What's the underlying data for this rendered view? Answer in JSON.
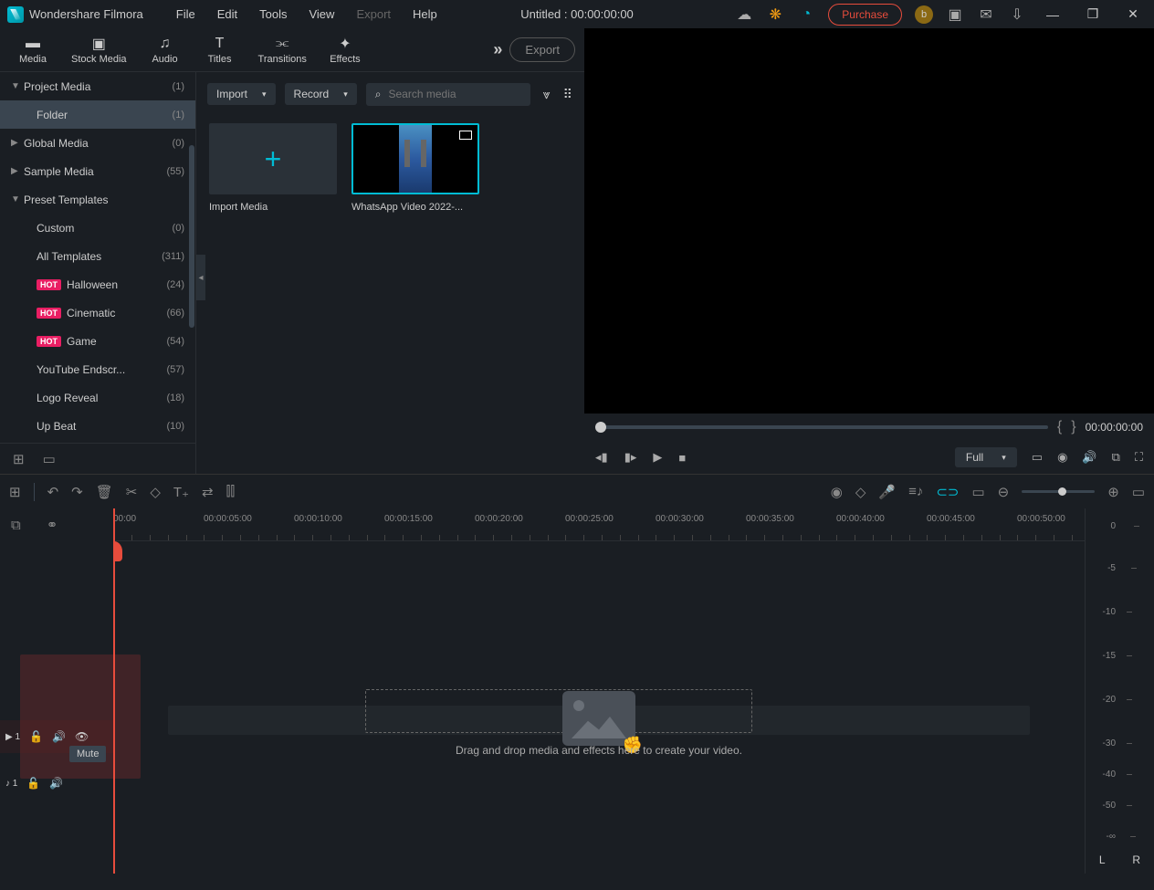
{
  "app_name": "Wondershare Filmora",
  "menu": [
    "File",
    "Edit",
    "Tools",
    "View",
    "Export",
    "Help"
  ],
  "title": "Untitled : 00:00:00:00",
  "purchase": "Purchase",
  "avatar": "b",
  "tabs": [
    {
      "name": "media",
      "label": "Media"
    },
    {
      "name": "stock",
      "label": "Stock Media"
    },
    {
      "name": "audio",
      "label": "Audio"
    },
    {
      "name": "titles",
      "label": "Titles"
    },
    {
      "name": "transitions",
      "label": "Transitions"
    },
    {
      "name": "effects",
      "label": "Effects"
    }
  ],
  "export_btn": "Export",
  "sidebar": [
    {
      "label": "Project Media",
      "count": "(1)",
      "arrow": "▼"
    },
    {
      "label": "Folder",
      "count": "(1)",
      "child": true,
      "selected": true
    },
    {
      "label": "Global Media",
      "count": "(0)",
      "arrow": "▶"
    },
    {
      "label": "Sample Media",
      "count": "(55)",
      "arrow": "▶"
    },
    {
      "label": "Preset Templates",
      "count": "",
      "arrow": "▼"
    },
    {
      "label": "Custom",
      "count": "(0)",
      "child2": true
    },
    {
      "label": "All Templates",
      "count": "(311)",
      "child2": true
    },
    {
      "label": "Halloween",
      "count": "(24)",
      "child2": true,
      "hot": true
    },
    {
      "label": "Cinematic",
      "count": "(66)",
      "child2": true,
      "hot": true
    },
    {
      "label": "Game",
      "count": "(54)",
      "child2": true,
      "hot": true
    },
    {
      "label": "YouTube Endscr...",
      "count": "(57)",
      "child2": true
    },
    {
      "label": "Logo Reveal",
      "count": "(18)",
      "child2": true
    },
    {
      "label": "Up Beat",
      "count": "(10)",
      "child2": true
    }
  ],
  "import": "Import",
  "record": "Record",
  "search_ph": "Search media",
  "import_media": "Import Media",
  "clip_name": "WhatsApp Video 2022-...",
  "preview": {
    "time": "00:00:00:00",
    "full": "Full"
  },
  "timeline": {
    "marks": [
      "00:00",
      "00:00:05:00",
      "00:00:10:00",
      "00:00:15:00",
      "00:00:20:00",
      "00:00:25:00",
      "00:00:30:00",
      "00:00:35:00",
      "00:00:40:00",
      "00:00:45:00",
      "00:00:50:00"
    ],
    "drop_text": "Drag and drop media and effects here to create your video.",
    "mute": "Mute"
  },
  "db_marks": [
    {
      "v": "0",
      "t": 14
    },
    {
      "v": "-5",
      "t": 60
    },
    {
      "v": "-10",
      "t": 108
    },
    {
      "v": "-15",
      "t": 156
    },
    {
      "v": "-20",
      "t": 204
    },
    {
      "v": "-30",
      "t": 252
    },
    {
      "v": "-40",
      "t": 286
    },
    {
      "v": "-50",
      "t": 320
    },
    {
      "v": "-∞",
      "t": 354
    }
  ],
  "hot": "HOT"
}
